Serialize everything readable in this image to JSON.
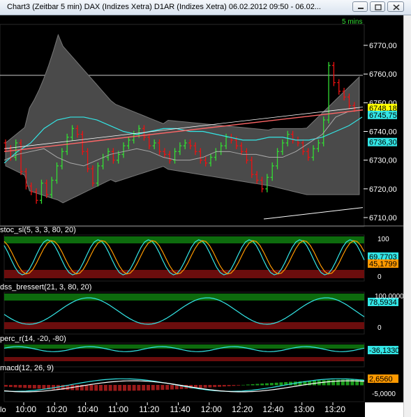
{
  "window": {
    "title": "Chart3 (Zeitbar 5 min)  DAX (Indizes Xetra) D1AR (Indizes Xetra) 06.02.2012 09:50 - 06.02...",
    "buttons": {
      "minimize": "minimize-icon",
      "restore": "restore-icon",
      "close": "close-icon"
    }
  },
  "colors": {
    "background": "#000000",
    "bullish": "#33dd33",
    "bearish": "#ee1111",
    "band": "#555555",
    "cyan": "#33e6e6",
    "orange": "#ff9900",
    "zone_green": "#0d6b0d",
    "zone_red": "#6b0d0d"
  },
  "timeframe_label": "5 mins",
  "main_panel": {
    "price_ticks": [
      "6770,00",
      "6760,00",
      "6750,00",
      "6740,00",
      "6730,00",
      "6720,00",
      "6710,00"
    ],
    "last_price_tags": [
      {
        "text": "6748,18",
        "bg": "#ffff00",
        "fg": "#000000"
      },
      {
        "text": "6745,75",
        "bg": "#33e6e6",
        "fg": "#000000"
      },
      {
        "text": "6736,30",
        "bg": "#33e6e6",
        "fg": "#000000"
      }
    ]
  },
  "indicators": [
    {
      "label": "stoc_sl(5, 3, 3, 80, 20)",
      "ticks": [
        "100",
        "0"
      ],
      "values": [
        {
          "text": "69,7703",
          "bg": "#33e6e6"
        },
        {
          "text": "45,1799",
          "bg": "#ff9900"
        }
      ]
    },
    {
      "label": "dss_bressert(21, 3, 80, 20)",
      "ticks": [
        "100,0000",
        "0"
      ],
      "values": [
        {
          "text": "78,5934",
          "bg": "#33e6e6"
        }
      ]
    },
    {
      "label": "perc_r(14, -20, -80)",
      "ticks": [],
      "values": [
        {
          "text": "-36,1330",
          "bg": "#33e6e6"
        }
      ]
    },
    {
      "label": "macd(12, 26, 9)",
      "ticks": [
        "-5,0000"
      ],
      "values": [
        {
          "text": "2,6560",
          "bg": "#ff9900"
        }
      ]
    }
  ],
  "time_axis": {
    "left_label": "lo",
    "labels": [
      "10:00",
      "10:20",
      "10:40",
      "11:00",
      "11:20",
      "11:40",
      "12:00",
      "12:20",
      "12:40",
      "13:00",
      "13:20"
    ]
  }
}
